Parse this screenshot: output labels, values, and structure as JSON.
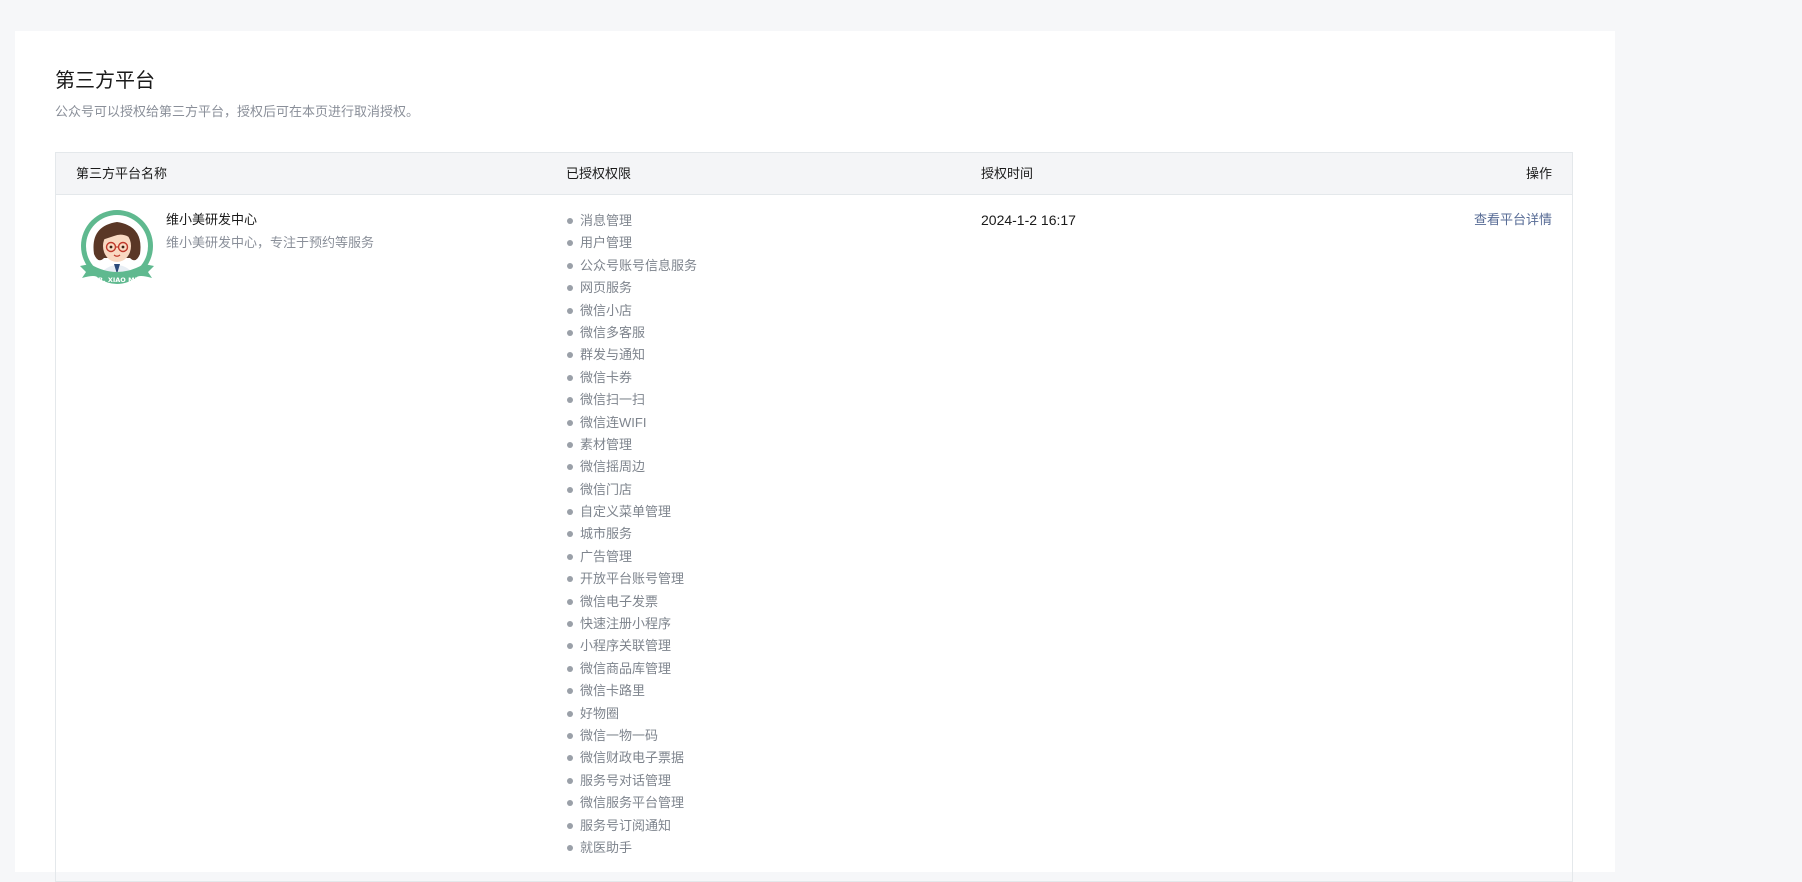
{
  "page": {
    "title": "第三方平台",
    "description": "公众号可以授权给第三方平台，授权后可在本页进行取消授权。"
  },
  "table": {
    "headers": {
      "name": "第三方平台名称",
      "permissions": "已授权权限",
      "time": "授权时间",
      "operation": "操作"
    },
    "rows": [
      {
        "name": "维小美研发中心",
        "description": "维小美研发中心，专注于预约等服务",
        "avatar_text": "DR. XIAO MEI",
        "auth_time": "2024-1-2 16:17",
        "action_label": "查看平台详情",
        "permissions": [
          "消息管理",
          "用户管理",
          "公众号账号信息服务",
          "网页服务",
          "微信小店",
          "微信多客服",
          "群发与通知",
          "微信卡券",
          "微信扫一扫",
          "微信连WIFI",
          "素材管理",
          "微信摇周边",
          "微信门店",
          "自定义菜单管理",
          "城市服务",
          "广告管理",
          "开放平台账号管理",
          "微信电子发票",
          "快速注册小程序",
          "小程序关联管理",
          "微信商品库管理",
          "微信卡路里",
          "好物圈",
          "微信一物一码",
          "微信财政电子票据",
          "服务号对话管理",
          "微信服务平台管理",
          "服务号订阅通知",
          "就医助手"
        ]
      }
    ]
  },
  "colors": {
    "background": "#f6f7f9",
    "link": "#576b95",
    "avatar_ring": "#5fb98f"
  }
}
